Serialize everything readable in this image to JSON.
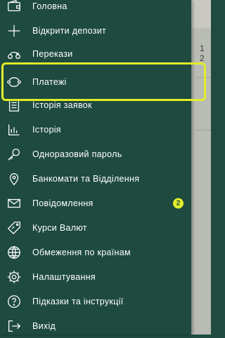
{
  "menu": {
    "items": [
      {
        "label": "Головна",
        "icon": "wallet-icon"
      },
      {
        "label": "Відкрити депозит",
        "icon": "plus-icon"
      },
      {
        "label": "Перекази",
        "icon": "transfer-icon"
      },
      {
        "label": "Платежі",
        "icon": "payments-icon"
      },
      {
        "label": "Історія заявок",
        "icon": "document-icon"
      },
      {
        "label": "Історія",
        "icon": "bar-chart-icon"
      },
      {
        "label": "Одноразовий пароль",
        "icon": "key-icon"
      },
      {
        "label": "Банкомати та Відділення",
        "icon": "location-pin-icon"
      },
      {
        "label": "Повідомлення",
        "icon": "mail-icon",
        "badge": "2"
      },
      {
        "label": "Курси Валют",
        "icon": "currency-tag-icon"
      },
      {
        "label": "Обмеження по країнам",
        "icon": "globe-icon"
      },
      {
        "label": "Налаштування",
        "icon": "gear-icon"
      },
      {
        "label": "Підказки та інструкції",
        "icon": "help-icon"
      },
      {
        "label": "Вихід",
        "icon": "logout-icon"
      }
    ]
  },
  "background": {
    "partial_number": "1 2"
  },
  "colors": {
    "drawer_bg": "#1e4a3f",
    "highlight": "#e0ec2b",
    "badge": "#e3f02a",
    "text": "#ffffff"
  }
}
